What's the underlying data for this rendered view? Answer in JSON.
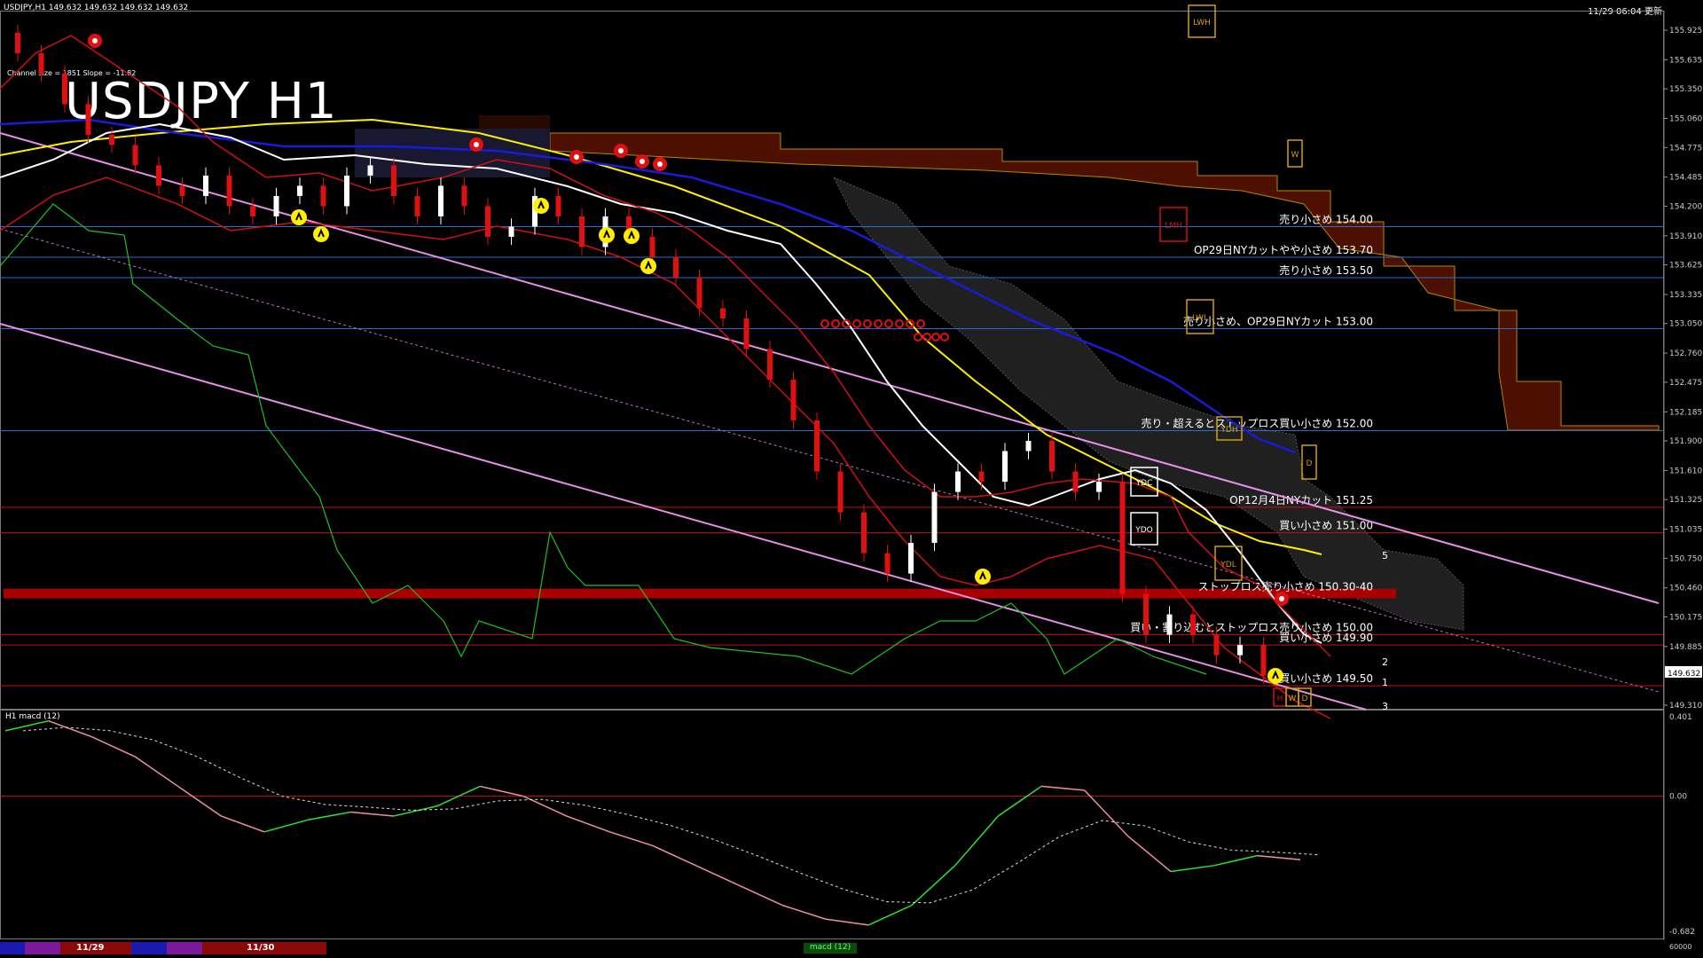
{
  "header": {
    "symbol_info": "USDJPY,H1  149.632 149.632 149.632 149.632",
    "datetime": "11/29 06:04 更新",
    "big_title": "USDJPY H1",
    "channel_info": "Channel size = 1851 Slope = -11.82",
    "indicator_label": "H1  macd (12)"
  },
  "price_axis": {
    "ticks": [
      "155.925",
      "155.635",
      "155.350",
      "155.060",
      "154.775",
      "154.485",
      "154.200",
      "153.910",
      "153.625",
      "153.335",
      "153.050",
      "152.760",
      "152.475",
      "152.185",
      "151.900",
      "151.610",
      "151.325",
      "151.035",
      "150.750",
      "150.460",
      "150.175",
      "149.885",
      "149.632",
      "149.310"
    ],
    "current": "149.632"
  },
  "macd_axis": {
    "ticks": [
      "0.401",
      "0.00",
      "-0.682",
      "60000"
    ]
  },
  "levels": [
    {
      "price": 154.0,
      "label": "売り小さめ 154.00",
      "color": "#2a6bd4"
    },
    {
      "price": 153.7,
      "label": "OP29日NYカットやや小さめ 153.70",
      "color": "#2a6bd4"
    },
    {
      "price": 153.5,
      "label": "売り小さめ 153.50",
      "color": "#2a6bd4"
    },
    {
      "price": 153.0,
      "label": "売り小さめ、OP29日NYカット 153.00",
      "color": "#2a6bd4"
    },
    {
      "price": 152.0,
      "label": "売り・超えるとストップロス買い小さめ 152.00",
      "color": "#2a6bd4"
    },
    {
      "price": 151.25,
      "label": "OP12月4日NYカット 151.25",
      "color": "#c01010"
    },
    {
      "price": 151.0,
      "label": "買い小さめ 151.00",
      "color": "#c01010"
    },
    {
      "price": 150.4,
      "label": "ストップロス売り小さめ 150.30-40",
      "color": "#c01010"
    },
    {
      "price": 150.0,
      "label": "買い・割り込むとストップロス売り小さめ 150.00",
      "color": "#c01010"
    },
    {
      "price": 149.9,
      "label": "買い小さめ 149.90",
      "color": "#c01010"
    },
    {
      "price": 149.5,
      "label": "買い小さめ 149.50",
      "color": "#c01010"
    }
  ],
  "markers": {
    "lwh": "LWH",
    "lmh": "LMH",
    "lwl": "LWL",
    "ydh": "YDH",
    "ydc": "YDC",
    "ydo": "YDO",
    "ydl": "YDL",
    "w": "W",
    "d": "D",
    "h": "H",
    "w2": "W",
    "d2": "D"
  },
  "fib_labels": [
    "5",
    "2",
    "1",
    "3"
  ],
  "bottom_bar": {
    "dates": [
      "11/29",
      "11/30"
    ],
    "indicator_tab": "macd (12)"
  },
  "colors": {
    "background": "#000000",
    "bull": "#ffffff",
    "bear": "#e01010",
    "cloud": "#ff6a00",
    "accent_yellow": "#ffee00",
    "channel": "#ee82ee"
  },
  "chart_data": {
    "type": "line",
    "close": [
      155.7,
      155.5,
      155.2,
      154.9,
      154.8,
      154.6,
      154.4,
      154.3,
      154.5,
      154.2,
      154.1,
      154.3,
      154.4,
      154.2,
      154.5,
      154.6,
      154.3,
      154.1,
      154.4,
      154.2,
      153.9,
      154.0,
      154.3,
      154.1,
      153.8,
      154.1,
      153.9,
      153.7,
      153.5,
      153.2,
      153.1,
      152.8,
      152.5,
      152.1,
      151.6,
      151.2,
      150.8,
      150.6,
      150.9,
      151.4,
      151.6,
      151.5,
      151.8,
      151.9,
      151.6,
      151.4,
      151.5,
      150.4,
      150.0,
      150.2,
      150.0,
      149.8,
      149.9,
      149.6
    ],
    "macd": [
      0.33,
      0.38,
      0.3,
      0.2,
      0.05,
      -0.1,
      -0.18,
      -0.12,
      -0.08,
      -0.1,
      -0.05,
      0.05,
      0.0,
      -0.1,
      -0.18,
      -0.25,
      -0.35,
      -0.45,
      -0.55,
      -0.62,
      -0.65,
      -0.55,
      -0.35,
      -0.1,
      0.05,
      0.03,
      -0.2,
      -0.38,
      -0.35,
      -0.3,
      -0.32
    ]
  }
}
